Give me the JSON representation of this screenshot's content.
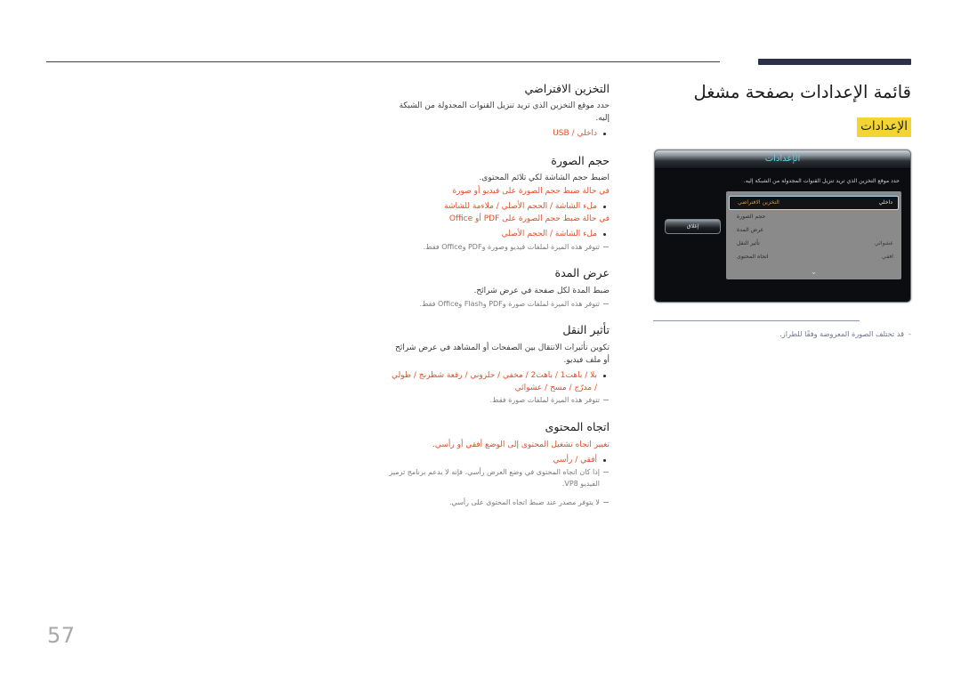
{
  "header": {
    "title": "قائمة الإعدادات بصفحة مشغل",
    "badge": "الإعدادات"
  },
  "device_panel": {
    "titlebar": "الإعدادات",
    "description": "حدد موقع التخزين الذي تريد تنزيل القنوات المجدولة من الشبكة إليه.",
    "close_label": "إغلاق",
    "chevron_icon": "⌄",
    "rows": [
      {
        "label": "التخزين الافتراضي",
        "value": "داخلي",
        "selected": true
      },
      {
        "label": "حجم الصورة",
        "value": "",
        "selected": false
      },
      {
        "label": "عرض المدة",
        "value": "",
        "selected": false
      },
      {
        "label": "تأثير النقل",
        "value": "عشوائي",
        "selected": false
      },
      {
        "label": "اتجاه المحتوى",
        "value": "افقي",
        "selected": false
      }
    ],
    "caption_dash": "-",
    "caption": "قد تختلف الصورة المعروضة وفقًا للطراز."
  },
  "sections": [
    {
      "title": "التخزين الافتراضي",
      "desc": "حدد موقع التخزين الذي تريد تنزيل القنوات المجدولة من الشبكة إليه.",
      "options": [
        "داخلي / USB"
      ],
      "notes": []
    },
    {
      "title": "حجم الصورة",
      "desc": "اضبط حجم الشاشة لكي تلائم المحتوى.",
      "sub1": "في حالة ضبط حجم الصورة على فيديو أو صورة",
      "options1": [
        "ملء الشاشة / الحجم الأصلي / ملاءمة للشاشة"
      ],
      "sub2": "في حالة ضبط حجم الصورة على PDF أو Office",
      "options2": [
        "ملء الشاشة / الحجم الأصلي"
      ],
      "notes": [
        "تتوفر هذه الميزة لملفات فيديو وصورة وPDF وOffice فقط."
      ]
    },
    {
      "title": "عرض المدة",
      "desc": "ضبط المدة لكل صفحة في عرض شرائح.",
      "options": [],
      "notes": [
        "تتوفر هذه الميزة لملفات صورة وPDF وFlash وOffice فقط."
      ]
    },
    {
      "title": "تأثير النقل",
      "desc": "تكوين تأثيرات الانتقال بين الصفحات أو المشاهد في عرض شرائح أو ملف فيديو.",
      "options": [
        "بلا / باهت1 / باهت2 / مخفي / حلزوني / رقعة شطرنج / طولي / مدرّج / مسح / عشوائي"
      ],
      "notes": [
        "تتوفر هذه الميزة لملفات صورة فقط."
      ]
    },
    {
      "title": "اتجاه المحتوى",
      "desc": "تغيير اتجاه تشغيل المحتوى إلى الوضع أفقي أو رأسي.",
      "options": [
        "أفقي / رأسي"
      ],
      "notes": [
        "إذا كان اتجاه المحتوى في وضع العرض رأسي، فإنه لا يدعم برنامج ترميز الفيديو VP8.",
        "لا يتوفر مصدر عند ضبط اتجاه المحتوى على رأسي."
      ]
    }
  ],
  "footer": {
    "page_number": "57"
  },
  "colors": {
    "accent": "#e4502a",
    "highlight": "#f2d533",
    "rule": "#2c3149",
    "panel_title": "#63d0e8"
  }
}
